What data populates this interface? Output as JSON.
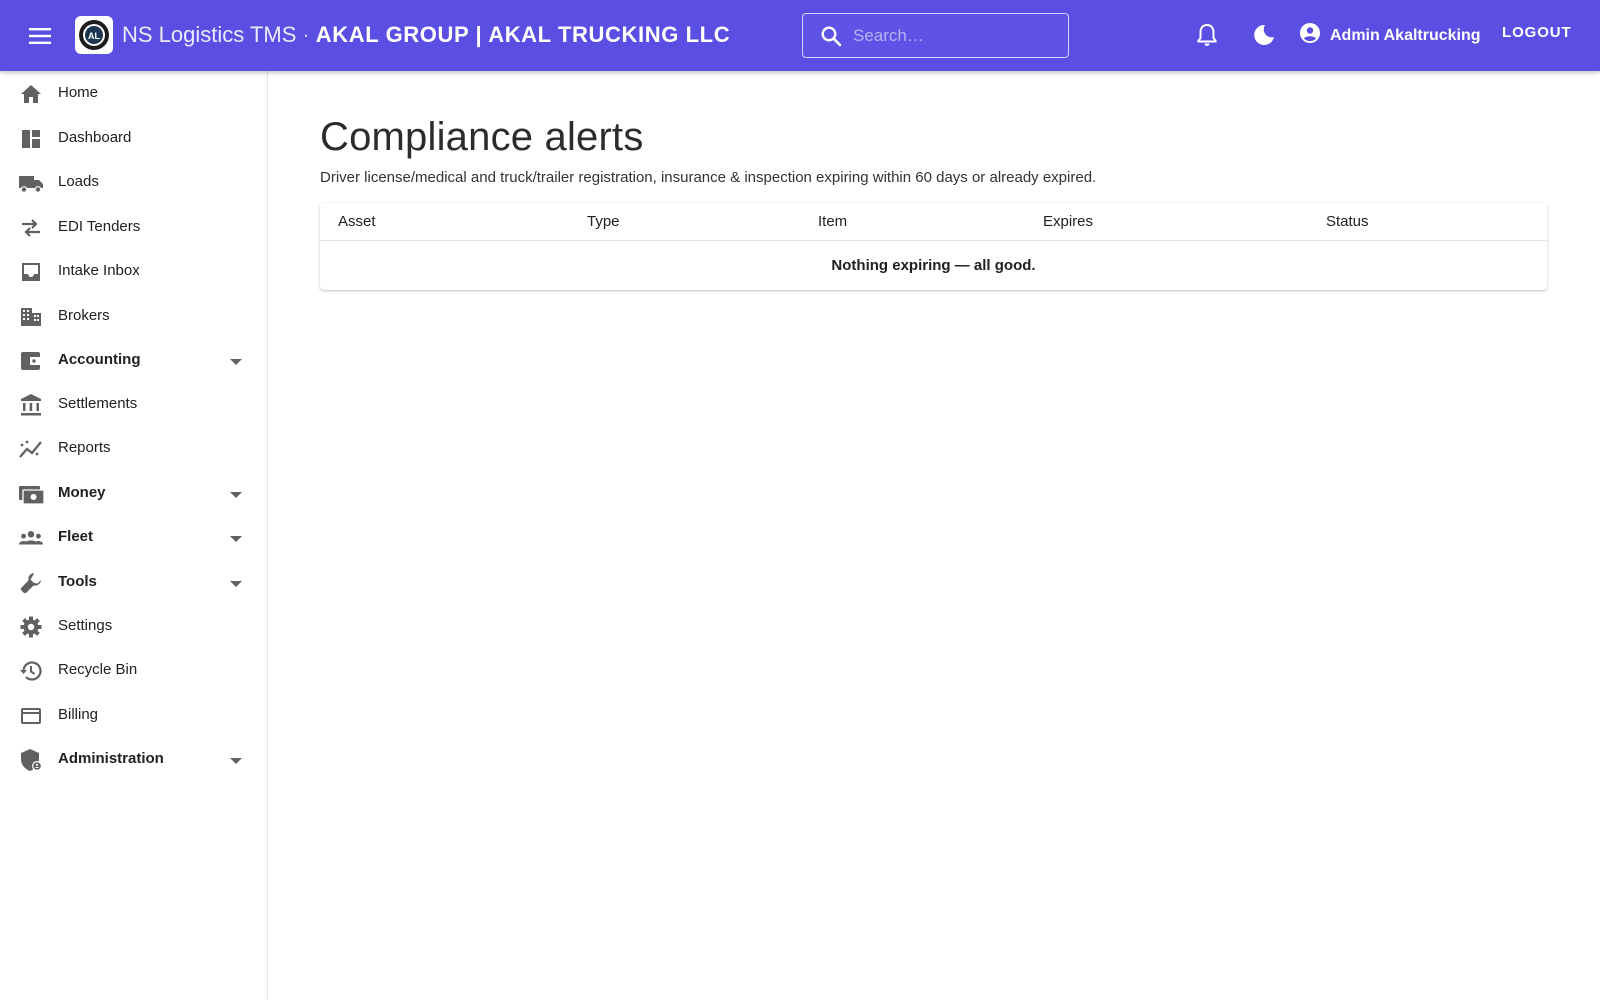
{
  "header": {
    "app_name": "NS Logistics TMS",
    "separator": "·",
    "company": "AKAL GROUP | AKAL TRUCKING LLC",
    "search_placeholder": "Search…",
    "user_name": "Admin Akaltrucking",
    "logout_label": "LOGOUT",
    "accent_color": "#5b4ee3"
  },
  "sidebar": {
    "items": [
      {
        "label": "Home",
        "icon": "home-icon"
      },
      {
        "label": "Dashboard",
        "icon": "dashboard-icon"
      },
      {
        "label": "Loads",
        "icon": "truck-icon"
      },
      {
        "label": "EDI Tenders",
        "icon": "swap-arrows-icon"
      },
      {
        "label": "Intake Inbox",
        "icon": "inbox-icon"
      },
      {
        "label": "Brokers",
        "icon": "building-icon"
      },
      {
        "label": "Accounting",
        "icon": "wallet-icon",
        "expandable": true
      },
      {
        "label": "Settlements",
        "icon": "bank-icon"
      },
      {
        "label": "Reports",
        "icon": "trend-chart-icon"
      },
      {
        "label": "Money",
        "icon": "money-icon",
        "expandable": true
      },
      {
        "label": "Fleet",
        "icon": "people-icon",
        "expandable": true
      },
      {
        "label": "Tools",
        "icon": "wrench-icon",
        "expandable": true
      },
      {
        "label": "Settings",
        "icon": "gear-icon"
      },
      {
        "label": "Recycle Bin",
        "icon": "history-icon"
      },
      {
        "label": "Billing",
        "icon": "credit-card-icon"
      },
      {
        "label": "Administration",
        "icon": "admin-shield-icon",
        "expandable": true
      }
    ]
  },
  "main": {
    "title": "Compliance alerts",
    "description": "Driver license/medical and truck/trailer registration, insurance & inspection expiring within 60 days or already expired.",
    "table": {
      "columns": [
        "Asset",
        "Type",
        "Item",
        "Expires",
        "Status"
      ],
      "empty_message": "Nothing expiring — all good."
    }
  }
}
